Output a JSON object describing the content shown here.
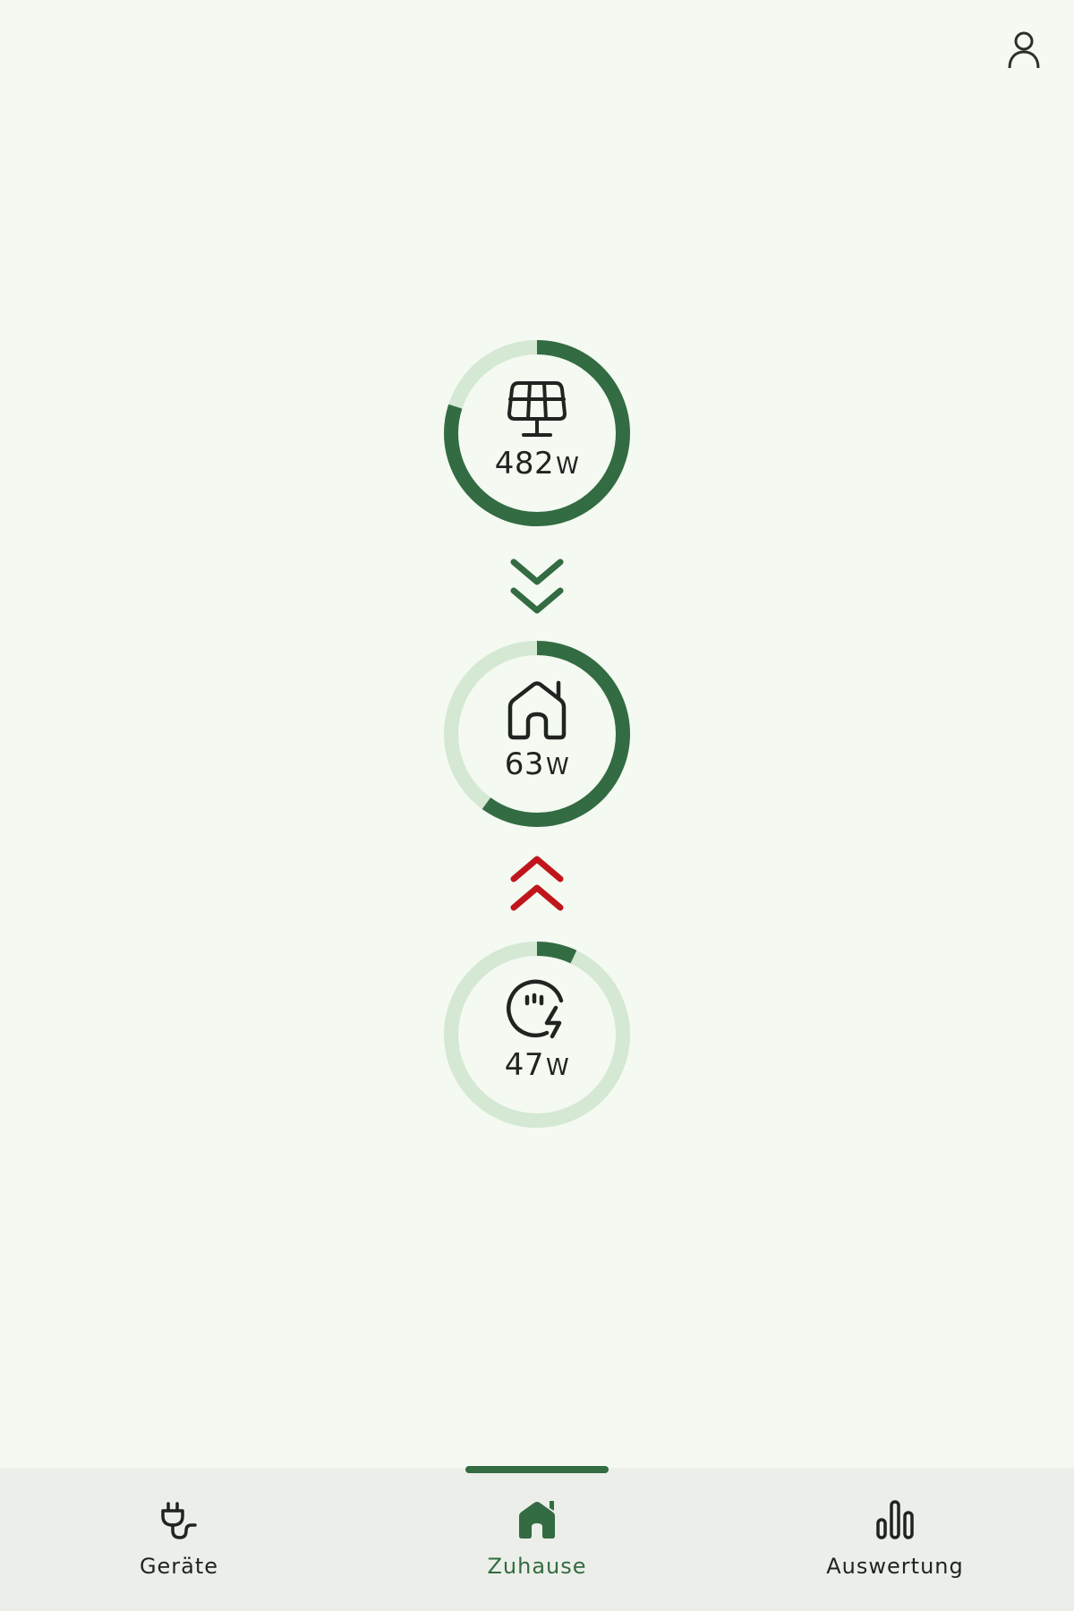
{
  "header": {
    "profile_icon": "person-icon"
  },
  "colors": {
    "ring_active": "#336b42",
    "ring_track": "#d4e8d3",
    "flow_in": "#336b42",
    "flow_out": "#c0161b",
    "background": "#f4f9f1",
    "nav_background": "#ecefe9"
  },
  "flow": {
    "solar": {
      "icon": "solar-panel-icon",
      "value": "482",
      "unit": "W",
      "fill_fraction": 0.8
    },
    "solar_to_home": {
      "icon": "double-chevron-down-icon",
      "direction": "down"
    },
    "home": {
      "icon": "home-icon",
      "value": "63",
      "unit": "W",
      "fill_fraction": 0.6
    },
    "grid_to_home": {
      "icon": "double-chevron-up-icon",
      "direction": "up"
    },
    "grid": {
      "icon": "grid-meter-icon",
      "value": "47",
      "unit": "W",
      "fill_fraction": 0.07
    }
  },
  "nav": {
    "items": [
      {
        "label": "Geräte",
        "icon": "plug-icon",
        "active": false
      },
      {
        "label": "Zuhause",
        "icon": "home-filled-icon",
        "active": true
      },
      {
        "label": "Auswertung",
        "icon": "bar-chart-icon",
        "active": false
      }
    ]
  }
}
